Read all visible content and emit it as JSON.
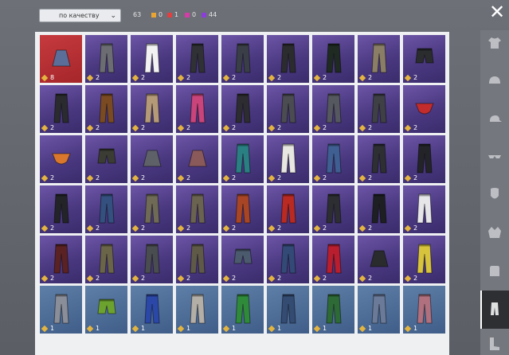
{
  "sort": {
    "label": "по качеству"
  },
  "total_count": "63",
  "rarity_counts": [
    {
      "name": "orange",
      "color": "#e9a431",
      "count": "0"
    },
    {
      "name": "red",
      "color": "#e04040",
      "count": "1"
    },
    {
      "name": "pink",
      "color": "#d63ca8",
      "count": "0"
    },
    {
      "name": "purple",
      "color": "#8b3fd8",
      "count": "44"
    }
  ],
  "items": [
    {
      "q": "8",
      "r": "legend",
      "c": "#5a6e99",
      "t": "skirt"
    },
    {
      "q": "2",
      "r": "epic",
      "c": "#6b6d72",
      "t": "pants"
    },
    {
      "q": "2",
      "r": "epic",
      "c": "#f2f2f2",
      "t": "pants"
    },
    {
      "q": "2",
      "r": "epic",
      "c": "#2f3134",
      "t": "pants"
    },
    {
      "q": "2",
      "r": "epic",
      "c": "#3a3f47",
      "t": "pants"
    },
    {
      "q": "2",
      "r": "epic",
      "c": "#2b2c2e",
      "t": "pants"
    },
    {
      "q": "2",
      "r": "epic",
      "c": "#1f2a22",
      "t": "pants"
    },
    {
      "q": "2",
      "r": "epic",
      "c": "#8a7e66",
      "t": "pants"
    },
    {
      "q": "2",
      "r": "epic",
      "c": "#2a2c2e",
      "t": "shorts"
    },
    {
      "q": "2",
      "r": "epic",
      "c": "#2a2b2e",
      "t": "pants"
    },
    {
      "q": "2",
      "r": "epic",
      "c": "#7a4a22",
      "t": "pants"
    },
    {
      "q": "2",
      "r": "epic",
      "c": "#b59a78",
      "t": "pants"
    },
    {
      "q": "2",
      "r": "epic",
      "c": "#c8447a",
      "t": "pants"
    },
    {
      "q": "2",
      "r": "epic",
      "c": "#2d2d31",
      "t": "pants"
    },
    {
      "q": "2",
      "r": "epic",
      "c": "#4a4c51",
      "t": "pants"
    },
    {
      "q": "2",
      "r": "epic",
      "c": "#55585e",
      "t": "pants"
    },
    {
      "q": "2",
      "r": "epic",
      "c": "#3e4046",
      "t": "pants"
    },
    {
      "q": "2",
      "r": "epic",
      "c": "#c22c2c",
      "t": "briefs"
    },
    {
      "q": "2",
      "r": "epic",
      "c": "#d9782c",
      "t": "briefs"
    },
    {
      "q": "2",
      "r": "epic",
      "c": "#3b3c33",
      "t": "shorts"
    },
    {
      "q": "2",
      "r": "epic",
      "c": "#5e6168",
      "t": "skirt"
    },
    {
      "q": "2",
      "r": "epic",
      "c": "#8a5a5a",
      "t": "skirt"
    },
    {
      "q": "2",
      "r": "epic",
      "c": "#2a7f82",
      "t": "pants"
    },
    {
      "q": "2",
      "r": "epic",
      "c": "#e8e6e0",
      "t": "pants"
    },
    {
      "q": "2",
      "r": "epic",
      "c": "#3f5f92",
      "t": "pants"
    },
    {
      "q": "2",
      "r": "epic",
      "c": "#2d2f33",
      "t": "pants"
    },
    {
      "q": "2",
      "r": "epic",
      "c": "#232427",
      "t": "pants"
    },
    {
      "q": "2",
      "r": "epic",
      "c": "#232427",
      "t": "pants"
    },
    {
      "q": "2",
      "r": "epic",
      "c": "#33507e",
      "t": "pants"
    },
    {
      "q": "2",
      "r": "epic",
      "c": "#6e6a55",
      "t": "pants"
    },
    {
      "q": "2",
      "r": "epic",
      "c": "#6a6350",
      "t": "pants"
    },
    {
      "q": "2",
      "r": "epic",
      "c": "#a84525",
      "t": "pants"
    },
    {
      "q": "2",
      "r": "epic",
      "c": "#b82a22",
      "t": "pants"
    },
    {
      "q": "2",
      "r": "epic",
      "c": "#2c2e31",
      "t": "pants"
    },
    {
      "q": "2",
      "r": "epic",
      "c": "#1e1f22",
      "t": "pants"
    },
    {
      "q": "2",
      "r": "epic",
      "c": "#e6e6e8",
      "t": "pants"
    },
    {
      "q": "2",
      "r": "epic",
      "c": "#5a2222",
      "t": "pants"
    },
    {
      "q": "2",
      "r": "epic",
      "c": "#6a6548",
      "t": "pants"
    },
    {
      "q": "2",
      "r": "epic",
      "c": "#4a4d50",
      "t": "pants"
    },
    {
      "q": "2",
      "r": "epic",
      "c": "#5f5a48",
      "t": "pants"
    },
    {
      "q": "2",
      "r": "epic",
      "c": "#4c5a6e",
      "t": "shorts"
    },
    {
      "q": "2",
      "r": "epic",
      "c": "#334a77",
      "t": "pants"
    },
    {
      "q": "2",
      "r": "epic",
      "c": "#b81e2e",
      "t": "pants"
    },
    {
      "q": "2",
      "r": "epic",
      "c": "#2a2b2d",
      "t": "skirt"
    },
    {
      "q": "2",
      "r": "epic",
      "c": "#d8c43c",
      "t": "pants"
    },
    {
      "q": "1",
      "r": "rare",
      "c": "#8a8e98",
      "t": "pants"
    },
    {
      "q": "1",
      "r": "rare",
      "c": "#6ca32e",
      "t": "shorts"
    },
    {
      "q": "1",
      "r": "rare",
      "c": "#2b48a8",
      "t": "pants"
    },
    {
      "q": "1",
      "r": "rare",
      "c": "#b3aea6",
      "t": "pants"
    },
    {
      "q": "1",
      "r": "rare",
      "c": "#2f8a3a",
      "t": "pants"
    },
    {
      "q": "1",
      "r": "rare",
      "c": "#344b72",
      "t": "pants"
    },
    {
      "q": "1",
      "r": "rare",
      "c": "#2d6a35",
      "t": "pants"
    },
    {
      "q": "1",
      "r": "rare",
      "c": "#6a7a98",
      "t": "pants"
    },
    {
      "q": "1",
      "r": "rare",
      "c": "#b0707e",
      "t": "pants"
    }
  ],
  "sidebar": [
    {
      "name": "tshirt-icon"
    },
    {
      "name": "helmet-icon"
    },
    {
      "name": "cap-icon"
    },
    {
      "name": "glasses-icon"
    },
    {
      "name": "mask-icon"
    },
    {
      "name": "jacket-icon"
    },
    {
      "name": "backpack-icon"
    },
    {
      "name": "pants-icon",
      "active": true
    },
    {
      "name": "boots-icon"
    }
  ]
}
